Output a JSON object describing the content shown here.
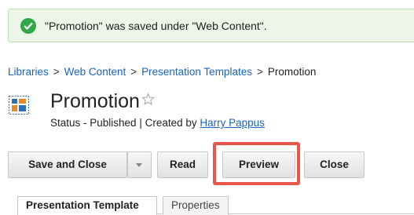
{
  "alert": {
    "message": "\"Promotion\" was saved under \"Web Content\".",
    "icon": "check-circle-icon",
    "color": "#30a845"
  },
  "breadcrumb": {
    "items": [
      "Libraries",
      "Web Content",
      "Presentation Templates",
      "Promotion"
    ],
    "separator": ">"
  },
  "header": {
    "icon": "presentation-template-icon",
    "title": "Promotion",
    "status_prefix": "Status - Published | Created by ",
    "author": "Harry Pappus"
  },
  "toolbar": {
    "save_close": "Save and Close",
    "read": "Read",
    "preview": "Preview",
    "close": "Close"
  },
  "tabs": [
    {
      "label": "Presentation Template",
      "active": true
    },
    {
      "label": "Properties",
      "active": false
    }
  ],
  "highlight_color": "#e8564a"
}
